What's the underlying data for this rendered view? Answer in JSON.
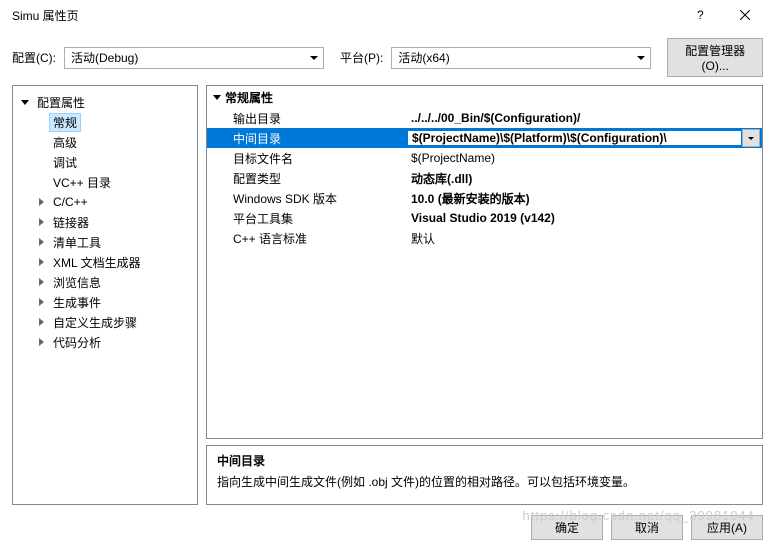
{
  "titlebar": {
    "title": "Simu 属性页"
  },
  "config_row": {
    "config_label": "配置(C):",
    "config_value": "活动(Debug)",
    "platform_label": "平台(P):",
    "platform_value": "活动(x64)",
    "manager_button": "配置管理器(O)..."
  },
  "tree": {
    "root": "配置属性",
    "items": [
      "常规",
      "高级",
      "调试",
      "VC++ 目录",
      "C/C++",
      "链接器",
      "清单工具",
      "XML 文档生成器",
      "浏览信息",
      "生成事件",
      "自定义生成步骤",
      "代码分析"
    ],
    "expandable": [
      false,
      false,
      false,
      false,
      true,
      true,
      true,
      true,
      true,
      true,
      true,
      true
    ],
    "selected_index": 0
  },
  "properties": {
    "header": "常规属性",
    "rows": [
      {
        "name": "输出目录",
        "value": "../../../00_Bin/$(Configuration)/"
      },
      {
        "name": "中间目录",
        "value": "$(ProjectName)\\$(Platform)\\$(Configuration)\\"
      },
      {
        "name": "目标文件名",
        "value": "$(ProjectName)"
      },
      {
        "name": "配置类型",
        "value": "动态库(.dll)"
      },
      {
        "name": "Windows SDK 版本",
        "value": "10.0 (最新安装的版本)"
      },
      {
        "name": "平台工具集",
        "value": "Visual Studio 2019 (v142)"
      },
      {
        "name": "C++ 语言标准",
        "value": "默认"
      }
    ],
    "selected_index": 1
  },
  "description": {
    "title": "中间目录",
    "text": "指向生成中间生成文件(例如 .obj 文件)的位置的相对路径。可以包括环境变量。"
  },
  "buttons": {
    "ok": "确定",
    "cancel": "取消",
    "apply": "应用(A)"
  },
  "watermark": "https://blog.csdn.net/qq_39981044"
}
